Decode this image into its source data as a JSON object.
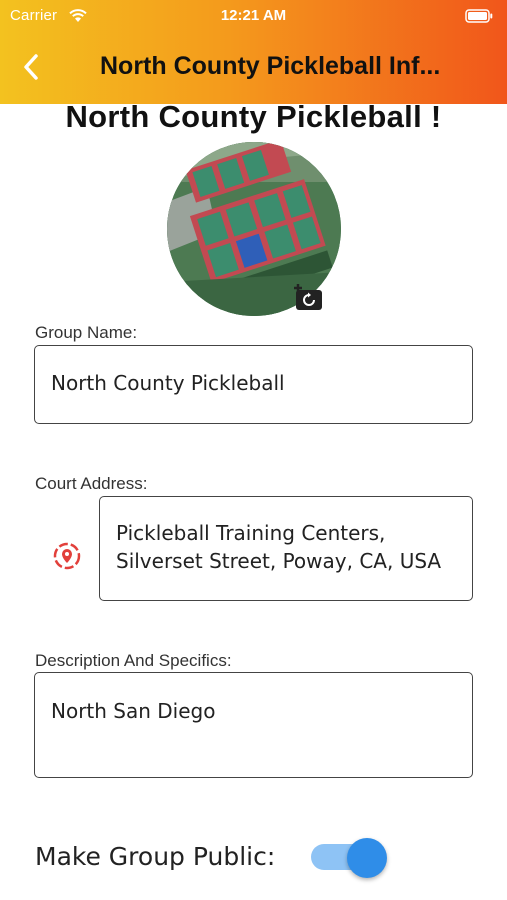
{
  "status_bar": {
    "carrier": "Carrier",
    "time": "12:21 AM",
    "icons": [
      "wifi-icon",
      "battery-icon"
    ]
  },
  "header": {
    "back_icon": "chevron-left-icon",
    "title": "North County Pickleball  Inf...",
    "gradient": [
      "#f3c21f",
      "#f49a1c",
      "#f1561b"
    ]
  },
  "page": {
    "title": "North County Pickleball !"
  },
  "avatar": {
    "image": "aerial-pickleball-courts-photo",
    "edit_icon": "camera-icon"
  },
  "form": {
    "group_name": {
      "label": "Group Name:",
      "value": "North County Pickleball"
    },
    "court_address": {
      "label": "Court Address:",
      "value_lines": [
        "Pickleball Training Centers,",
        "Silverset Street, Poway, CA, USA"
      ],
      "pin_icon": "location-pin-icon",
      "pin_color": "#e2403b"
    },
    "description": {
      "label": "Description And Specifics:",
      "value": "North San Diego"
    },
    "make_public": {
      "label": "Make Group Public:",
      "enabled": true,
      "accent": "#2f8de8"
    }
  }
}
